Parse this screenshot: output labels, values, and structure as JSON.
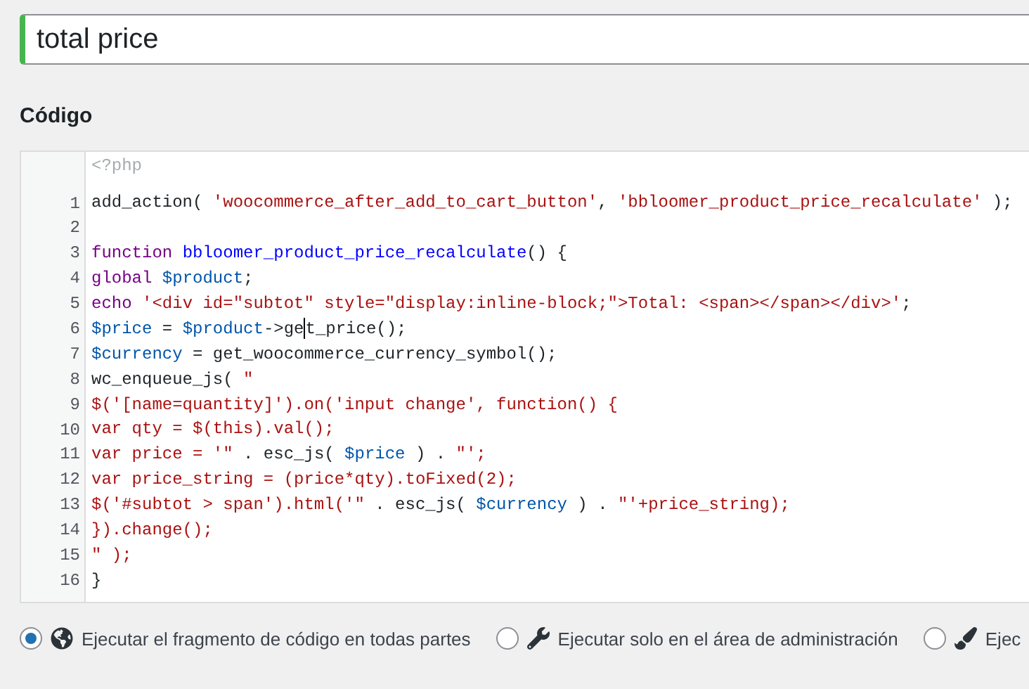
{
  "title_field": {
    "value": "total price"
  },
  "code_section": {
    "heading": "Código",
    "opening_tag": "<?php",
    "lines": [
      {
        "number": "1",
        "tokens": [
          {
            "kind": "plain",
            "text": "add_action( "
          },
          {
            "kind": "string",
            "text": "'woocommerce_after_add_to_cart_button'"
          },
          {
            "kind": "plain",
            "text": ", "
          },
          {
            "kind": "string",
            "text": "'bbloomer_product_price_recalculate'"
          },
          {
            "kind": "plain",
            "text": " );"
          }
        ]
      },
      {
        "number": "2"
      },
      {
        "number": "3",
        "tokens": [
          {
            "kind": "keyword",
            "text": "function "
          },
          {
            "kind": "def",
            "text": "bbloomer_product_price_recalculate"
          },
          {
            "kind": "plain",
            "text": "() {"
          }
        ]
      },
      {
        "number": "4",
        "tokens": [
          {
            "kind": "keyword",
            "text": "global "
          },
          {
            "kind": "variable",
            "text": "$product"
          },
          {
            "kind": "plain",
            "text": ";"
          }
        ]
      },
      {
        "number": "5",
        "tokens": [
          {
            "kind": "keyword",
            "text": "echo "
          },
          {
            "kind": "string",
            "text": "'<div id=\"subtot\" style=\"display:inline-block;\">Total: <span></span></div>'"
          },
          {
            "kind": "plain",
            "text": ";"
          }
        ]
      },
      {
        "number": "6",
        "tokens": [
          {
            "kind": "variable",
            "text": "$price"
          },
          {
            "kind": "plain",
            "text": " = "
          },
          {
            "kind": "variable",
            "text": "$product"
          },
          {
            "kind": "plain",
            "text": "->ge"
          },
          {
            "kind": "cursor"
          },
          {
            "kind": "plain",
            "text": "t_price();"
          }
        ]
      },
      {
        "number": "7",
        "tokens": [
          {
            "kind": "variable",
            "text": "$currency"
          },
          {
            "kind": "plain",
            "text": " = get_woocommerce_currency_symbol();"
          }
        ]
      },
      {
        "number": "8",
        "tokens": [
          {
            "kind": "plain",
            "text": "wc_enqueue_js( "
          },
          {
            "kind": "string",
            "text": "\""
          }
        ]
      },
      {
        "number": "9",
        "tokens": [
          {
            "kind": "string",
            "text": "$('[name=quantity]').on('input change', function() {"
          }
        ]
      },
      {
        "number": "10",
        "tokens": [
          {
            "kind": "string",
            "text": "var qty = $(this).val();"
          }
        ]
      },
      {
        "number": "11",
        "tokens": [
          {
            "kind": "string",
            "text": "var price = '\""
          },
          {
            "kind": "plain",
            "text": " . esc_js( "
          },
          {
            "kind": "variable",
            "text": "$price"
          },
          {
            "kind": "plain",
            "text": " ) . "
          },
          {
            "kind": "string",
            "text": "\"';"
          }
        ]
      },
      {
        "number": "12",
        "tokens": [
          {
            "kind": "string",
            "text": "var price_string = (price*qty).toFixed(2);"
          }
        ]
      },
      {
        "number": "13",
        "tokens": [
          {
            "kind": "string",
            "text": "$('#subtot > span').html('\""
          },
          {
            "kind": "plain",
            "text": " . esc_js( "
          },
          {
            "kind": "variable",
            "text": "$currency"
          },
          {
            "kind": "plain",
            "text": " ) . "
          },
          {
            "kind": "string",
            "text": "\"'+price_string);"
          }
        ]
      },
      {
        "number": "14",
        "tokens": [
          {
            "kind": "string",
            "text": "}).change();"
          }
        ]
      },
      {
        "number": "15",
        "tokens": [
          {
            "kind": "string",
            "text": "\" );"
          }
        ]
      },
      {
        "number": "16",
        "tokens": [
          {
            "kind": "plain",
            "text": "}"
          }
        ]
      }
    ]
  },
  "scope_options": [
    {
      "kind": "global",
      "label": "Ejecutar el fragmento de código en todas partes",
      "selected": true
    },
    {
      "kind": "admin",
      "label": "Ejecutar solo en el área de administración",
      "selected": false
    },
    {
      "kind": "frontend",
      "label": "Ejec",
      "selected": false
    }
  ]
}
